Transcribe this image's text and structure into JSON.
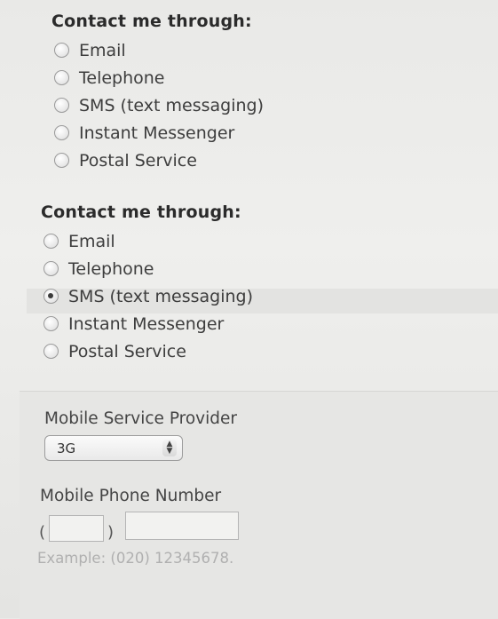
{
  "contact_group_1": {
    "title": "Contact me through:",
    "options": [
      {
        "label": "Email",
        "checked": false
      },
      {
        "label": "Telephone",
        "checked": false
      },
      {
        "label": "SMS (text messaging)",
        "checked": false
      },
      {
        "label": "Instant Messenger",
        "checked": false
      },
      {
        "label": "Postal Service",
        "checked": false
      }
    ]
  },
  "contact_group_2": {
    "title": "Contact me through:",
    "options": [
      {
        "label": "Email",
        "checked": false
      },
      {
        "label": "Telephone",
        "checked": false
      },
      {
        "label": "SMS (text messaging)",
        "checked": true
      },
      {
        "label": "Instant Messenger",
        "checked": false
      },
      {
        "label": "Postal Service",
        "checked": false
      }
    ]
  },
  "mobile": {
    "provider_label": "Mobile Service Provider",
    "provider_value": "3G",
    "phone_label": "Mobile Phone Number",
    "open_paren": "(",
    "close_paren": ")",
    "area_code_value": "",
    "number_value": "",
    "example": "Example: (020) 12345678."
  }
}
